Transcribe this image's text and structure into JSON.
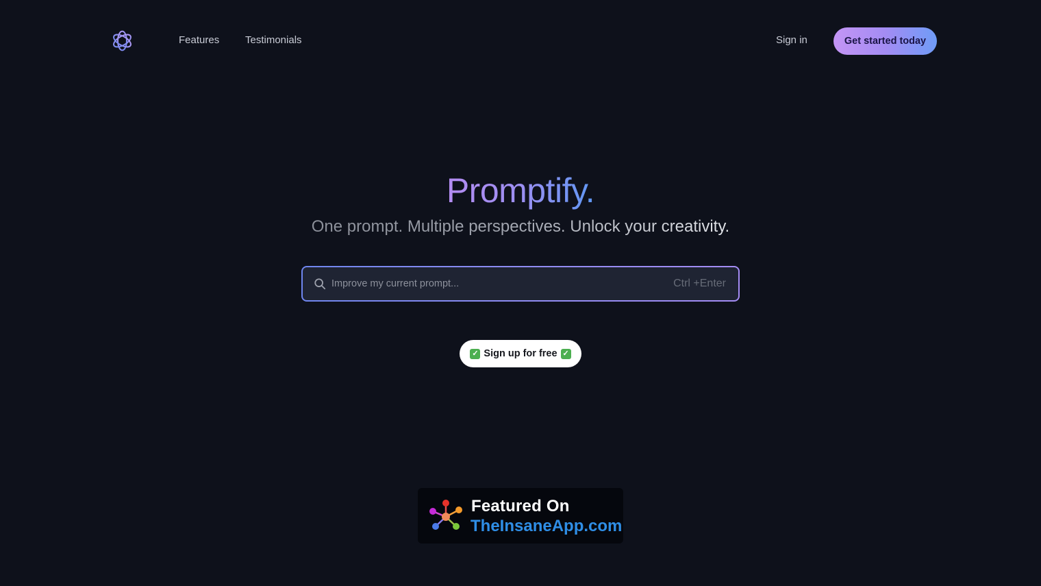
{
  "nav": {
    "logo_icon": "openai-knot-logo-icon",
    "links": [
      {
        "label": "Features"
      },
      {
        "label": "Testimonials"
      }
    ],
    "sign_in_label": "Sign in",
    "cta_label": "Get started today"
  },
  "hero": {
    "title": "Promptify.",
    "subtitle": "One prompt. Multiple perspectives. Unlock your creativity."
  },
  "search": {
    "icon": "search-icon",
    "placeholder": "Improve my current prompt...",
    "value": "",
    "shortcut": "Ctrl +Enter"
  },
  "signup": {
    "check_glyph": "✓",
    "label": "Sign up for free"
  },
  "badge": {
    "icon": "network-hub-icon",
    "line1": "Featured On",
    "line2": "TheInsaneApp.com"
  },
  "colors": {
    "background": "#0e111b",
    "accent_purple": "#b48cf2",
    "accent_blue": "#5f97f3",
    "badge_link": "#2f8ee6"
  }
}
